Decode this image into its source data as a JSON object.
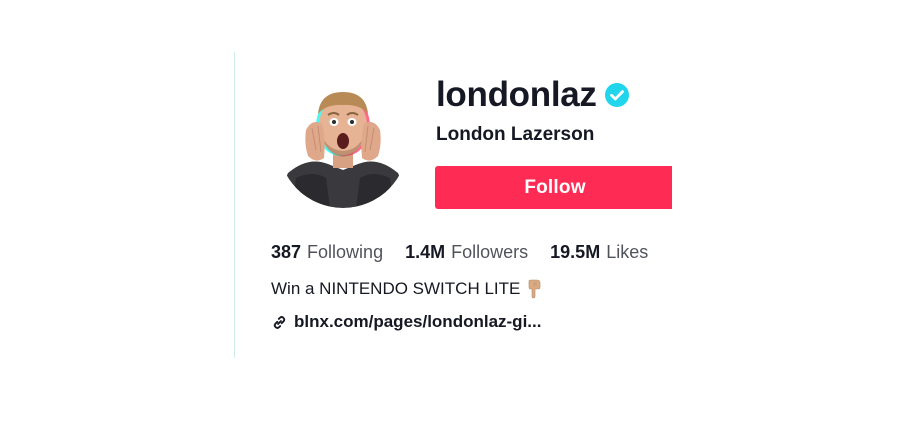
{
  "profile": {
    "username": "londonlaz",
    "display_name": "London Lazerson",
    "verified": true,
    "follow_label": "Follow",
    "stats": [
      {
        "value": "387",
        "label": "Following"
      },
      {
        "value": "1.4M",
        "label": "Followers"
      },
      {
        "value": "19.5M",
        "label": "Likes"
      }
    ],
    "bio": "Win a NINTENDO SWITCH LITE",
    "bio_emoji": "pointing-down-hand-icon",
    "link": "blnx.com/pages/londonlaz-gi..."
  },
  "colors": {
    "accent": "#fe2c55",
    "verified": "#20d5ec",
    "text": "#161823"
  }
}
